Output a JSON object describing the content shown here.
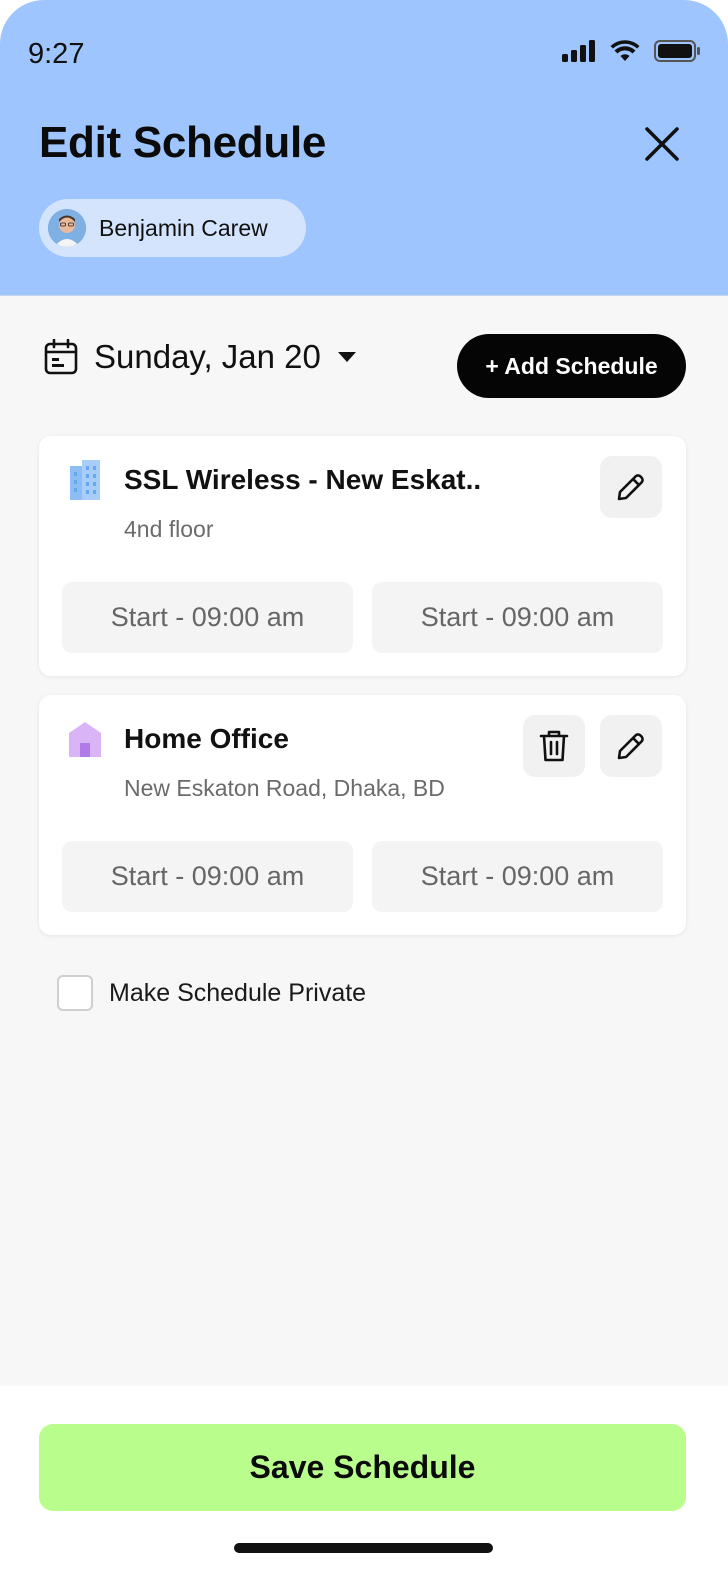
{
  "status_bar": {
    "time": "9:27"
  },
  "header": {
    "title": "Edit Schedule",
    "user_name": "Benjamin Carew"
  },
  "date_selector": {
    "label": "Sunday, Jan 20"
  },
  "add_button": {
    "label": "+ Add Schedule"
  },
  "schedules": [
    {
      "title": "SSL Wireless - New Eskat..",
      "subtitle": "4nd floor",
      "start_time": "Start - 09:00 am",
      "end_time": "Start - 09:00 am"
    },
    {
      "title": "Home Office",
      "subtitle": "New Eskaton Road, Dhaka, BD",
      "start_time": "Start - 09:00 am",
      "end_time": "Start - 09:00 am"
    }
  ],
  "private_option": {
    "label": "Make Schedule Private",
    "checked": false
  },
  "save_button": {
    "label": "Save Schedule"
  },
  "colors": {
    "header_bg": "#9ec5fe",
    "user_chip_bg": "#d4e4fd",
    "save_button_bg": "#b9fd8c",
    "add_button_bg": "#050505",
    "building_icon": "#8dbdf5",
    "home_icon": "#d9b4f7"
  },
  "icons": {
    "status": [
      "signal-icon",
      "wifi-icon",
      "battery-icon"
    ],
    "close": "close-icon",
    "calendar": "calendar-icon",
    "dropdown": "caret-down-icon",
    "edit": "pencil-icon",
    "delete": "trash-icon",
    "office": "building-icon",
    "home": "home-icon"
  }
}
